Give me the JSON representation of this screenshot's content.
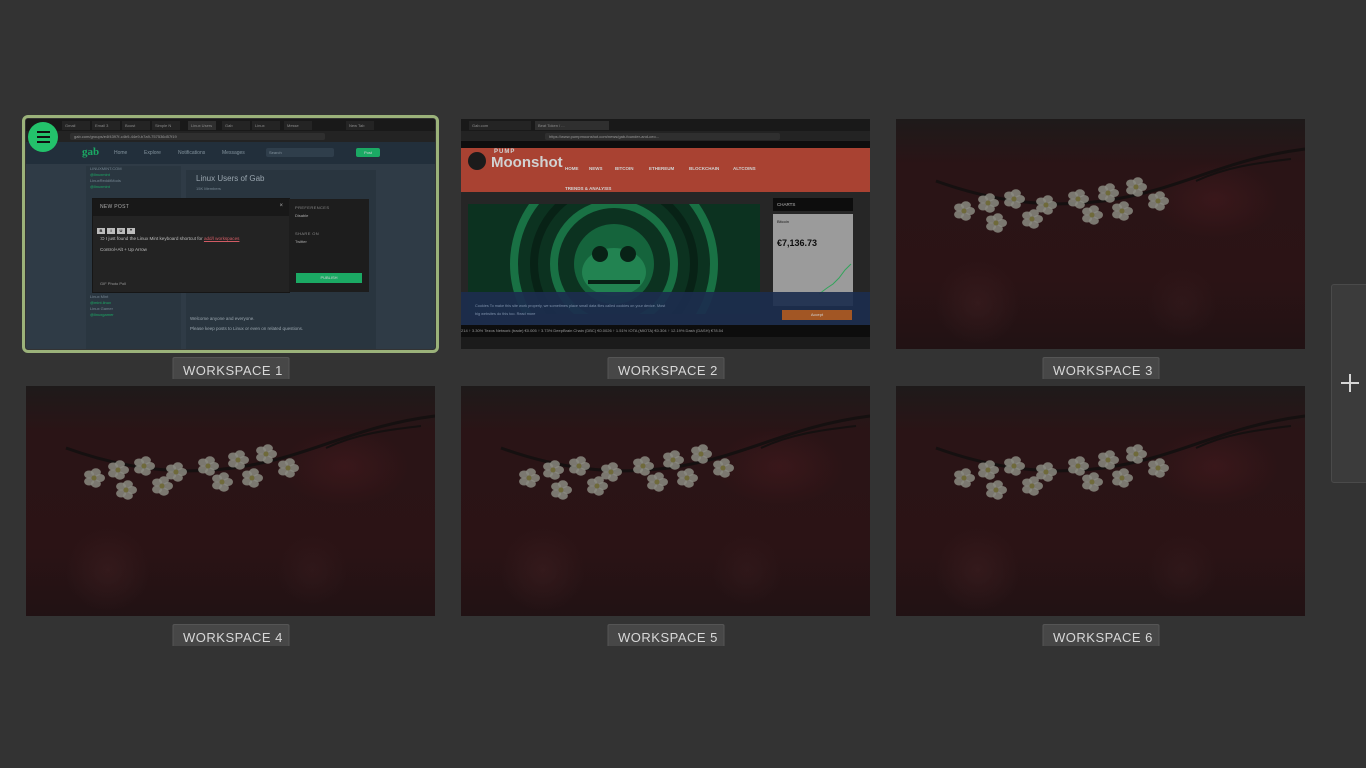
{
  "workspaces": [
    {
      "label": "WORKSPACE 1",
      "active": true
    },
    {
      "label": "WORKSPACE 2",
      "active": false
    },
    {
      "label": "WORKSPACE 3",
      "active": false
    },
    {
      "label": "WORKSPACE 4",
      "active": false
    },
    {
      "label": "WORKSPACE 5",
      "active": false
    },
    {
      "label": "WORKSPACE 6",
      "active": false
    }
  ],
  "ws1": {
    "url": "gab.com/groups/e4f4397f-c4b9-44e9-b7a9-757536d57f19",
    "tabs": [
      "Gmail",
      "Email 3",
      "Boost",
      "Simple N",
      "Linux Users",
      "Gab",
      "Linux",
      "Messe",
      "New Tab"
    ],
    "nav": [
      "Home",
      "Explore",
      "Notifications",
      "Messages"
    ],
    "logo": "gab",
    "search_placeholder": "Search",
    "post_button": "Post",
    "group_title": "Linux Users of Gab",
    "group_sub": "15K Members",
    "sidebar_lines": [
      "LINUXMINT.COM",
      "@linuxmint",
      "LinuxRedditMods",
      "@linuxmint",
      "Linux Mint",
      "@mint.linux",
      "Linux Gamer",
      "@linuxgamer"
    ],
    "feed_lines": [
      "Welcome anyone and everyone.",
      "Please keep posts to Linux or even on related questions."
    ],
    "new_post": {
      "title": "NEW POST",
      "close": "×",
      "tools": [
        "B",
        "I",
        "U",
        "❝"
      ],
      "text_prefix": ":D I just found the Linux Mint keyboard shortcut for ",
      "text_link": "add/l workspaces",
      "line2": "Control+Alt + Up Arrow",
      "footer": "GIF   Photo   Poll",
      "preferences_header": "PREFERENCES",
      "preferences_item": "Disable",
      "share_header": "SHARE ON",
      "share_item": "Twitter",
      "publish": "PUBLISH"
    }
  },
  "ws2": {
    "tabs": [
      "Gab.com",
      "Beat Token / ..."
    ],
    "url": "https://www.pumpmoonshot.com/news/gab-founder-and-ceo...",
    "logo_small": "PUMP",
    "logo": "Moonshot",
    "nav": [
      "HOME",
      "NEWS",
      "BITCOIN",
      "ETHEREUM",
      "BLOCKCHAIN",
      "ALTCOINS"
    ],
    "sub_nav": "TRENDS & ANALYSIS",
    "charts_header": "CHARTS",
    "coin": "Bitcoin",
    "price": "€7,136.73",
    "cookie_line1": "Cookies To make this site work properly, we sometimes place small data files called cookies on your device. Most",
    "cookie_line2": "big websites do this too.   Read more",
    "accept": "Accept",
    "ticker": "214  ↑ 3.30%   Tezos Network (trade)  €0.005  ↑ 3.73%   DeepBrain Chain (DBC)  €0.0026  ↑ 1.51%   IOTA (MIOTA)  €0.304  ↑ 12.19%   Dash (DASH)  €78.54"
  },
  "add_workspace": {
    "icon": "plus-icon"
  }
}
